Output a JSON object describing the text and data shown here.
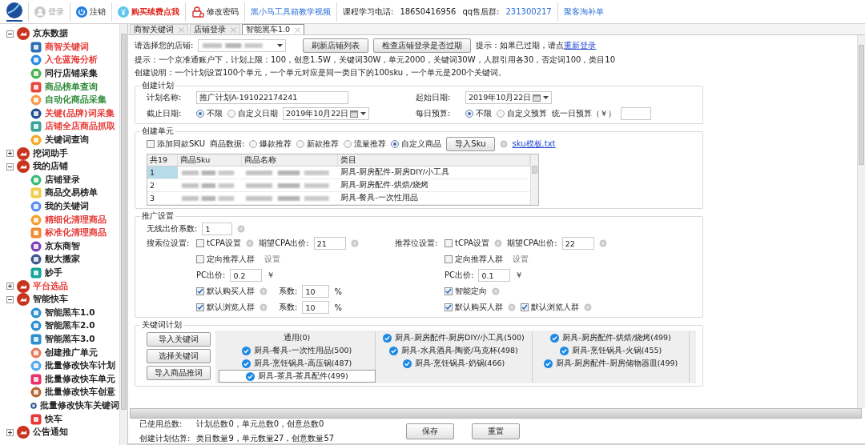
{
  "toolbar": {
    "items": [
      {
        "kind": "button",
        "label": "登录",
        "disabled": true
      },
      {
        "kind": "button",
        "label": "注销",
        "disabled": false
      },
      {
        "kind": "promo",
        "label": "购买续费点我"
      },
      {
        "kind": "button",
        "label": "修改密码",
        "disabled": false
      },
      {
        "kind": "link",
        "label": "黑小马工具箱教学视频"
      },
      {
        "kind": "text",
        "label": "课程学习电话:"
      },
      {
        "kind": "text",
        "label": "18650416956"
      },
      {
        "kind": "text",
        "label": "qq售后群:"
      },
      {
        "kind": "link",
        "label": "231300217"
      },
      {
        "kind": "link",
        "label": "聚客淘补单"
      }
    ]
  },
  "sidebar": {
    "groups": [
      {
        "label": "京东数据",
        "expanded": true,
        "color": "#222222",
        "children": [
          {
            "label": "商智关键词",
            "color": "#e53935"
          },
          {
            "label": "入仓蓝海分析",
            "color": "#e53935"
          },
          {
            "label": "同行店铺采集",
            "color": "#222222"
          },
          {
            "label": "商品榜单查询",
            "color": "#2e8b3a"
          },
          {
            "label": "自动化商品采集",
            "color": "#2e8b3a"
          },
          {
            "label": "关键(品牌)词采集",
            "color": "#e53935"
          },
          {
            "label": "店铺全店商品抓取",
            "color": "#e53935"
          },
          {
            "label": "关键词查询",
            "color": "#222222"
          }
        ]
      },
      {
        "label": "挖词助手",
        "expanded": false,
        "color": "#222222"
      },
      {
        "label": "我的店铺",
        "expanded": true,
        "color": "#222222",
        "children": [
          {
            "label": "店铺登录",
            "color": "#222222"
          },
          {
            "label": "商品交易榜单",
            "color": "#222222"
          },
          {
            "label": "我的关键词",
            "color": "#222222"
          },
          {
            "label": "精细化清理商品",
            "color": "#e53935"
          },
          {
            "label": "标准化清理商品",
            "color": "#e53935"
          },
          {
            "label": "京东商智",
            "color": "#222222"
          },
          {
            "label": "舰大搬家",
            "color": "#222222"
          },
          {
            "label": "妙手",
            "color": "#222222"
          }
        ]
      },
      {
        "label": "平台选品",
        "expanded": false,
        "color": "#e53935"
      },
      {
        "label": "智能快车",
        "expanded": true,
        "color": "#222222",
        "children": [
          {
            "label": "智能黑车1.0",
            "color": "#222222"
          },
          {
            "label": "智能黑车2.0",
            "color": "#222222"
          },
          {
            "label": "智能黑车3.0",
            "color": "#222222"
          },
          {
            "label": "创建推广单元",
            "color": "#222222"
          },
          {
            "label": "批量修改快车计划",
            "color": "#222222"
          },
          {
            "label": "批量修改快车单元",
            "color": "#222222"
          },
          {
            "label": "批量修改快车创意",
            "color": "#222222"
          },
          {
            "label": "批量修改快车关键词",
            "color": "#222222"
          },
          {
            "label": "快车",
            "color": "#222222"
          }
        ]
      },
      {
        "label": "公告通知",
        "expanded": false,
        "color": "#222222"
      }
    ]
  },
  "tabs": [
    {
      "label": "商智关键词",
      "selected": false
    },
    {
      "label": "店铺登录",
      "selected": false
    },
    {
      "label": "智能黑车1.0",
      "selected": true
    }
  ],
  "shop_row": {
    "label": "请选择您的店铺:",
    "buttons": [
      "刷新店铺列表",
      "检查店铺登录是否过期"
    ],
    "hint": "提示：如果已过期，请点",
    "hint_link": "重新登录"
  },
  "tips": [
    "提示：一个京准通账户下，计划上限：100，创意1.5W，关键词30W，单元2000，关键词30W，人群引用各30，否定词100，类目10",
    "创建说明：一个计划设置100个单元，一个单元对应是同一类目下的100sku，一个单元是200个关键词。"
  ],
  "plan": {
    "title": "创建计划",
    "name_label": "计划名称:",
    "name_value": "推广计划A-191022174241",
    "start_label": "起始日期:",
    "start_value": "2019年10月22日",
    "end_label": "截止日期:",
    "end_options": [
      {
        "label": "不限",
        "selected": true
      },
      {
        "label": "自定义日期",
        "selected": false
      }
    ],
    "end_value": "2019年10月22日",
    "budget_label": "每日预算:",
    "budget_options": [
      {
        "label": "不限",
        "selected": true
      },
      {
        "label": "自定义预算",
        "selected": false
      }
    ],
    "daily_label": "统一日预算（￥）"
  },
  "unit": {
    "title": "创建单元",
    "add_similar": {
      "label": "添加同款SKU",
      "checked": false
    },
    "source_label": "商品数据:",
    "sources": [
      {
        "label": "爆款推荐",
        "selected": false
      },
      {
        "label": "新款推荐",
        "selected": false
      },
      {
        "label": "流量推荐",
        "selected": false
      },
      {
        "label": "自定义商品",
        "selected": true
      }
    ],
    "import_button": "导入Sku",
    "template_link": "sku模板.txt",
    "table": {
      "columns": [
        "共19",
        "商品Sku",
        "商品名称",
        "类目"
      ],
      "rows": [
        {
          "index": "1",
          "category": "厨具-厨房配件-厨房DIY/小工具",
          "selected": true
        },
        {
          "index": "2",
          "category": "厨具-厨房配件-烘焙/烧烤",
          "selected": false
        },
        {
          "index": "3",
          "category": "厨具-餐具-一次性用品",
          "selected": false
        }
      ]
    }
  },
  "promo": {
    "title": "推广设置",
    "wireless_label": "无线出价系数:",
    "wireless_value": "1",
    "panes": [
      {
        "label": "搜索位设置:",
        "tcpa": {
          "label": "tCPA设置",
          "checked": false
        },
        "cpa_label": "期望CPA出价:",
        "cpa_value": "21",
        "targeting": {
          "label": "定向推荐人群",
          "checked": false
        },
        "setting": "设置",
        "pc_label": "PC出价:",
        "pc_value": "0.2",
        "currency": "￥",
        "crowd_rows": [
          [
            {
              "label": "默认购买人群",
              "checked": true,
              "coef_label": "系数:",
              "coef_value": "10",
              "unit": "%"
            }
          ],
          [
            {
              "label": "默认浏览人群",
              "checked": true,
              "coef_label": "系数:",
              "coef_value": "10",
              "unit": "%"
            }
          ]
        ]
      },
      {
        "label": "推荐位设置:",
        "tcpa": {
          "label": "tCPA设置",
          "checked": false
        },
        "cpa_label": "期望CPA出价:",
        "cpa_value": "22",
        "targeting": {
          "label": "定向推荐人群",
          "checked": false
        },
        "setting": "设置",
        "pc_label": "PC出价:",
        "pc_value": "0.1",
        "currency": "￥",
        "crowd_rows": [
          [
            {
              "label": "智能定向",
              "checked": true
            }
          ],
          [
            {
              "label": "默认购买人群",
              "checked": true
            },
            {
              "label": "默认浏览人群",
              "checked": true
            }
          ]
        ]
      }
    ]
  },
  "keywords": {
    "title": "关键词计划",
    "buttons": [
      "导入关键词",
      "选择关键词",
      "导入商品推词"
    ],
    "cells": [
      {
        "label": "通用(0)",
        "checked": false,
        "selected": false
      },
      {
        "label": "厨具-厨房配件-厨房DIY/小工具(500)",
        "checked": true,
        "selected": false
      },
      {
        "label": "厨具-厨房配件-烘焙/烧烤(499)",
        "checked": true,
        "selected": false
      },
      {
        "label": "厨具-餐具-一次性用品(500)",
        "checked": true,
        "selected": false
      },
      {
        "label": "厨具-水具酒具-陶瓷/马克杯(498)",
        "checked": true,
        "selected": false
      },
      {
        "label": "厨具-烹饪锅具-火锅(455)",
        "checked": true,
        "selected": false
      },
      {
        "label": "厨具-烹饪锅具-高压锅(487)",
        "checked": true,
        "selected": false
      },
      {
        "label": "厨具-烹饪锅具-奶锅(466)",
        "checked": true,
        "selected": false
      },
      {
        "label": "厨具-厨房配件-厨房储物器皿(499)",
        "checked": true,
        "selected": false
      },
      {
        "label": "厨具-茶具-茶具配件(499)",
        "checked": true,
        "selected": true
      }
    ]
  },
  "footer": {
    "used_label": "已使用总数:",
    "used_value": "计划总数0，单元总数0，创意总数0",
    "estimate_label": "创建计划估算:",
    "estimate_value": "类目数量9，单元数量27，创意数量57",
    "buttons": [
      "保存",
      "重置"
    ]
  }
}
